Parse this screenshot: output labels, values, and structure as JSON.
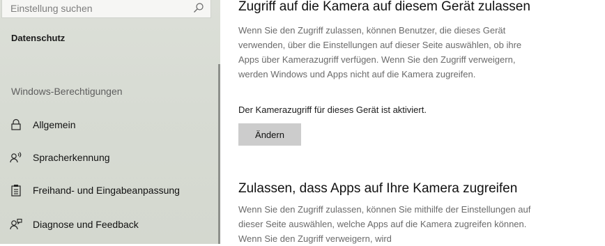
{
  "sidebar": {
    "search": {
      "placeholder": "Einstellung suchen",
      "icon": "search-icon"
    },
    "section_title": "Datenschutz",
    "group_title": "Windows-Berechtigungen",
    "items": [
      {
        "label": "Allgemein",
        "icon": "lock-icon"
      },
      {
        "label": "Spracherkennung",
        "icon": "speech-icon"
      },
      {
        "label": "Freihand- und Eingabeanpassung",
        "icon": "clipboard-icon"
      },
      {
        "label": "Diagnose und Feedback",
        "icon": "person-feedback-icon"
      }
    ]
  },
  "main": {
    "section1": {
      "heading": "Zugriff auf die Kamera auf diesem Gerät zulassen",
      "description": "Wenn Sie den Zugriff zulassen, können Benutzer, die dieses Gerät verwenden, über die Einstellungen auf dieser Seite auswählen, ob ihre Apps über Kamerazugriff verfügen. Wenn Sie den Zugriff verweigern, werden Windows und Apps nicht auf die Kamera zugreifen.",
      "status": "Der Kamerazugriff für dieses Gerät ist aktiviert.",
      "button_label": "Ändern"
    },
    "section2": {
      "heading": "Zulassen, dass Apps auf Ihre Kamera zugreifen",
      "description": "Wenn Sie den Zugriff zulassen, können Sie mithilfe der Einstellungen auf dieser Seite auswählen, welche Apps auf die Kamera zugreifen können. Wenn Sie den Zugriff verweigern, wird"
    }
  },
  "colors": {
    "sidebar_bg": "#d8dcd4",
    "button_bg": "#cccccc",
    "description_text": "#6a6a6a"
  }
}
